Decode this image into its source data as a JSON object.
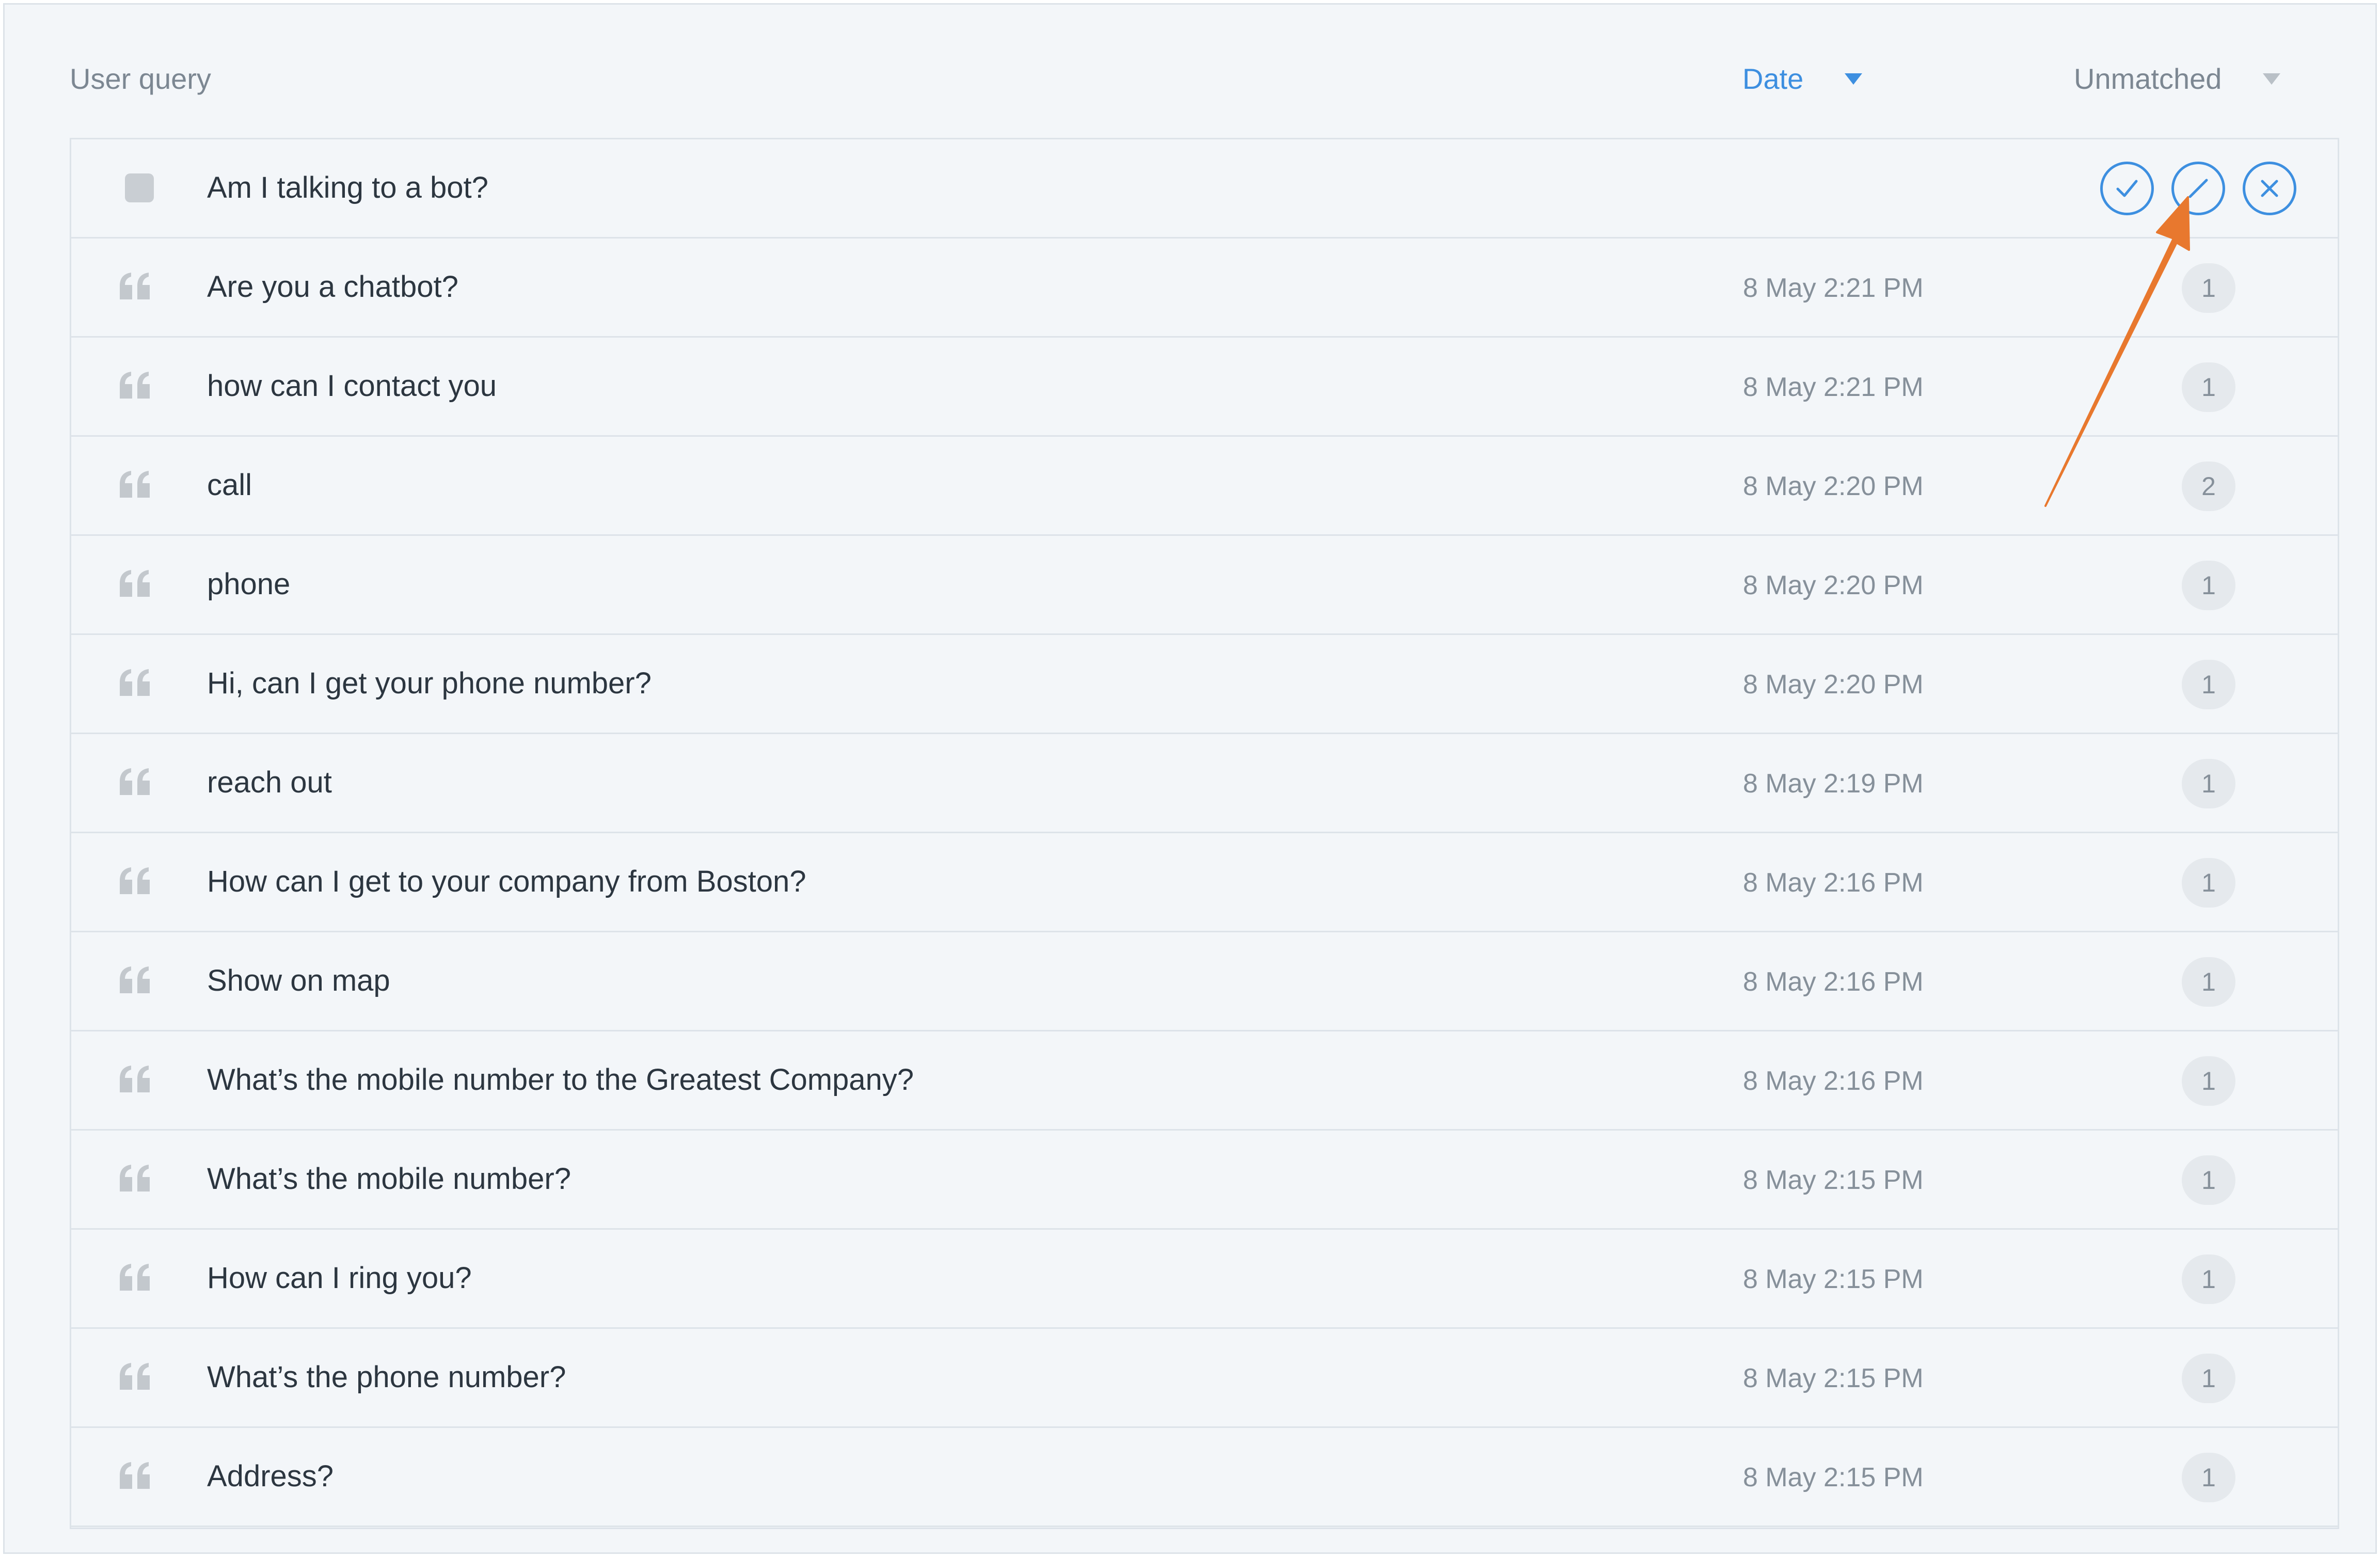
{
  "header": {
    "query_label": "User query",
    "date_label": "Date",
    "filter_label": "Unmatched"
  },
  "selected_row": {
    "text": "Am I talking to a bot?",
    "actions": [
      "check-icon",
      "edit-icon",
      "close-icon"
    ]
  },
  "rows": [
    {
      "text": "Are you a chatbot?",
      "date": "8 May 2:21 PM",
      "count": "1"
    },
    {
      "text": "how can I contact you",
      "date": "8 May 2:21 PM",
      "count": "1"
    },
    {
      "text": "call",
      "date": "8 May 2:20 PM",
      "count": "2"
    },
    {
      "text": "phone",
      "date": "8 May 2:20 PM",
      "count": "1"
    },
    {
      "text": "Hi, can I get your phone number?",
      "date": "8 May 2:20 PM",
      "count": "1"
    },
    {
      "text": "reach out",
      "date": "8 May 2:19 PM",
      "count": "1"
    },
    {
      "text": "How can I get to your company from Boston?",
      "date": "8 May 2:16 PM",
      "count": "1"
    },
    {
      "text": "Show on map",
      "date": "8 May 2:16 PM",
      "count": "1"
    },
    {
      "text": "What’s the mobile number to the Greatest Company?",
      "date": "8 May 2:16 PM",
      "count": "1"
    },
    {
      "text": "What’s the mobile number?",
      "date": "8 May 2:15 PM",
      "count": "1"
    },
    {
      "text": "How can I ring you?",
      "date": "8 May 2:15 PM",
      "count": "1"
    },
    {
      "text": "What’s the phone number?",
      "date": "8 May 2:15 PM",
      "count": "1"
    },
    {
      "text": "Address?",
      "date": "8 May 2:15 PM",
      "count": "1"
    }
  ],
  "colors": {
    "accent": "#3d8fe0",
    "annotation_arrow": "#e8782e",
    "background": "#f3f6f9"
  },
  "icons": {
    "row_lead": "quote-icon",
    "sort_caret": "caret-down-icon"
  }
}
